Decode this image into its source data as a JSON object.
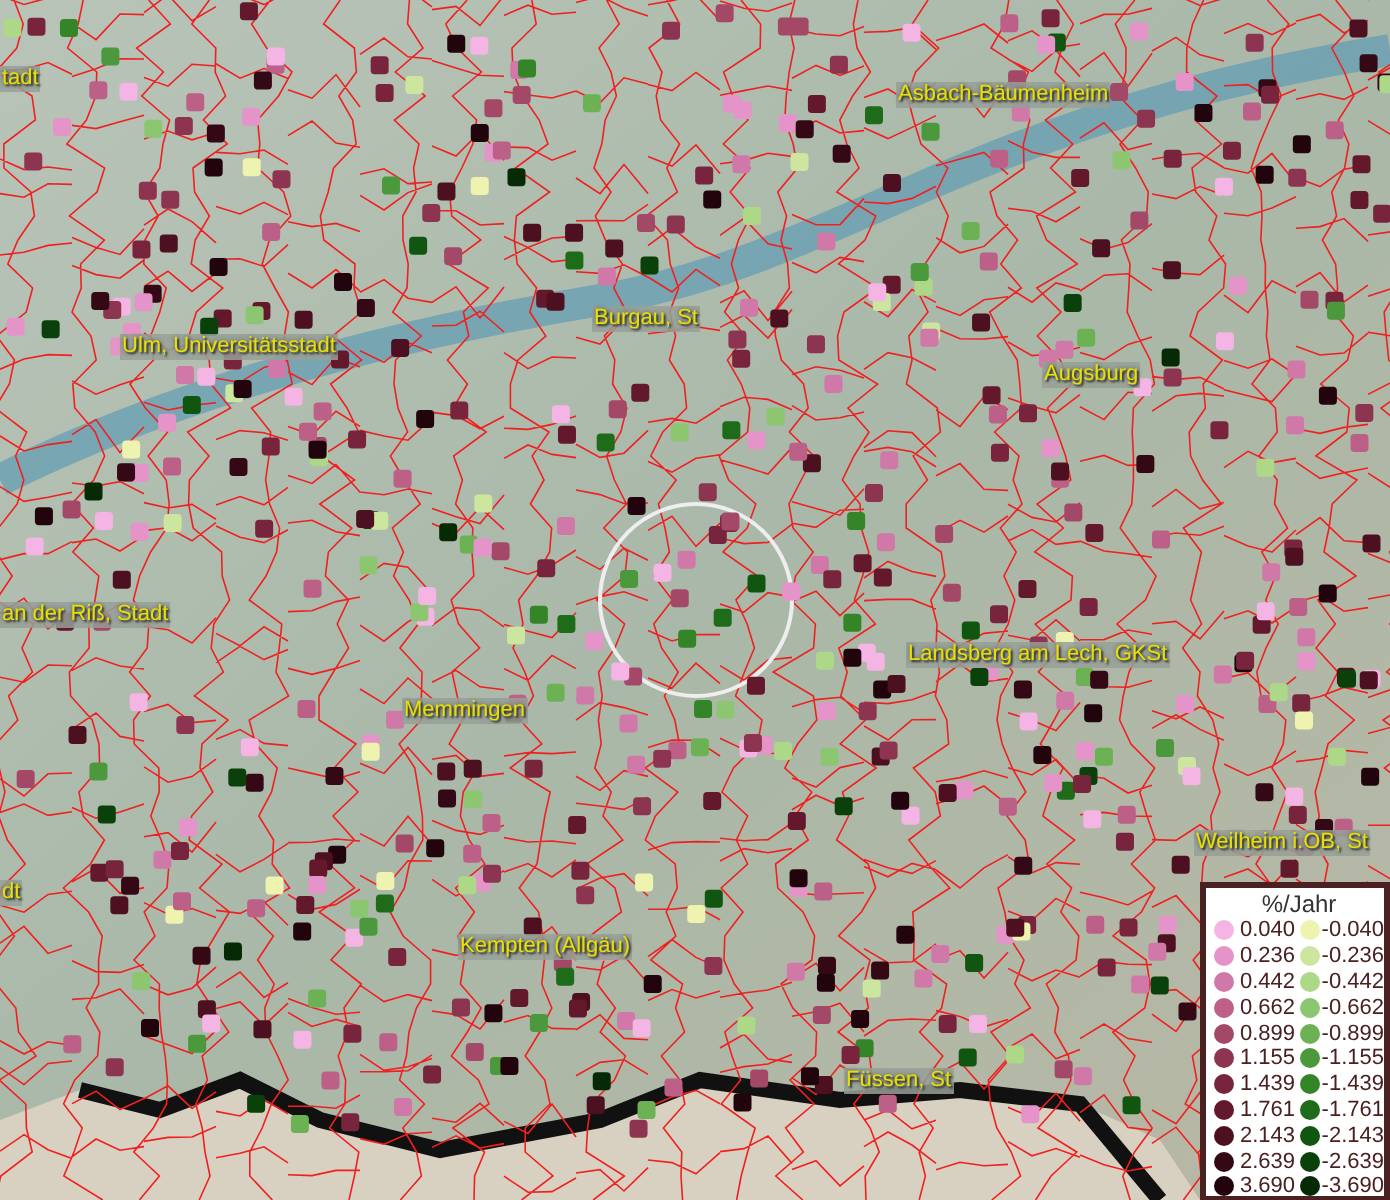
{
  "map": {
    "place_labels": [
      {
        "text": "tadt"
      },
      {
        "text": "Asbach-Bäumenheim"
      },
      {
        "text": "Burgau, St"
      },
      {
        "text": "Ulm, Universitätsstadt"
      },
      {
        "text": "Augsburg"
      },
      {
        "text": "an der Riß, Stadt"
      },
      {
        "text": "Landsberg am Lech, GKSt"
      },
      {
        "text": "Memmingen"
      },
      {
        "text": "Weilheim i.OB, St"
      },
      {
        "text": "dt"
      },
      {
        "text": "Kempten (Allgäu)"
      },
      {
        "text": "Füssen, St"
      }
    ]
  },
  "legend": {
    "title": "%/Jahr",
    "rows": [
      {
        "positive": {
          "value": "0.040",
          "color": "#f4b4e4"
        },
        "negative": {
          "value": "-0.040",
          "color": "#eef4b0"
        }
      },
      {
        "positive": {
          "value": "0.236",
          "color": "#e494c8"
        },
        "negative": {
          "value": "-0.236",
          "color": "#cce6a0"
        }
      },
      {
        "positive": {
          "value": "0.442",
          "color": "#d078a8"
        },
        "negative": {
          "value": "-0.442",
          "color": "#acd888"
        }
      },
      {
        "positive": {
          "value": "0.662",
          "color": "#bc6088"
        },
        "negative": {
          "value": "-0.662",
          "color": "#8cc670"
        }
      },
      {
        "positive": {
          "value": "0.899",
          "color": "#a44868"
        },
        "negative": {
          "value": "-0.899",
          "color": "#6cb254"
        }
      },
      {
        "positive": {
          "value": "1.155",
          "color": "#8c3450"
        },
        "negative": {
          "value": "-1.155",
          "color": "#4c983c"
        }
      },
      {
        "positive": {
          "value": "1.439",
          "color": "#78243c"
        },
        "negative": {
          "value": "-1.439",
          "color": "#348428"
        }
      },
      {
        "positive": {
          "value": "1.761",
          "color": "#64182c"
        },
        "negative": {
          "value": "-1.761",
          "color": "#1e6c1a"
        }
      },
      {
        "positive": {
          "value": "2.143",
          "color": "#4c1020"
        },
        "negative": {
          "value": "-2.143",
          "color": "#105610"
        }
      },
      {
        "positive": {
          "value": "2.639",
          "color": "#340814"
        },
        "negative": {
          "value": "-2.639",
          "color": "#0a400a"
        }
      },
      {
        "positive": {
          "value": "3.690",
          "color": "#22040c"
        },
        "negative": {
          "value": "-3.690",
          "color": "#062a06"
        }
      }
    ]
  }
}
